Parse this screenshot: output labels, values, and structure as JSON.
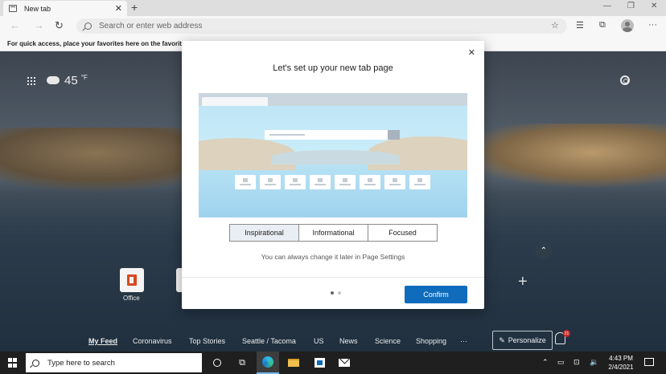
{
  "browser": {
    "tab_title": "New tab",
    "tab_close": "✕",
    "new_tab": "+",
    "window_controls": [
      "—",
      "❐",
      "✕"
    ],
    "address_placeholder": "Search or enter web address",
    "favorites_hint": "For quick access, place your favorites here on the favorites ba"
  },
  "ntp": {
    "weather_temp": "45",
    "weather_unit": "°F",
    "top_sites": [
      {
        "label": "Office"
      }
    ],
    "collapse_glyph": "⌃",
    "add_glyph": "+",
    "feed_tabs": [
      "My Feed",
      "Coronavirus",
      "Top Stories",
      "Seattle / Tacoma",
      "US",
      "News",
      "Science",
      "Shopping",
      "···"
    ],
    "personalize_label": "Personalize",
    "notifications_count": "21"
  },
  "dialog": {
    "title": "Let's set up your new tab page",
    "close": "✕",
    "options": [
      "Inspirational",
      "Informational",
      "Focused"
    ],
    "selected_option": "Inspirational",
    "hint": "You can always change it later in Page Settings",
    "confirm_label": "Confirm",
    "page_dots": 2,
    "active_dot": 0
  },
  "taskbar": {
    "search_placeholder": "Type here to search",
    "time": "4:43 PM",
    "date": "2/4/2021",
    "tray_glyphs": [
      "⌃",
      "▭",
      "⊡",
      "🔉"
    ]
  },
  "colors": {
    "accent": "#0f6cbd",
    "office": "#d64a1f",
    "badge": "#c62828"
  }
}
